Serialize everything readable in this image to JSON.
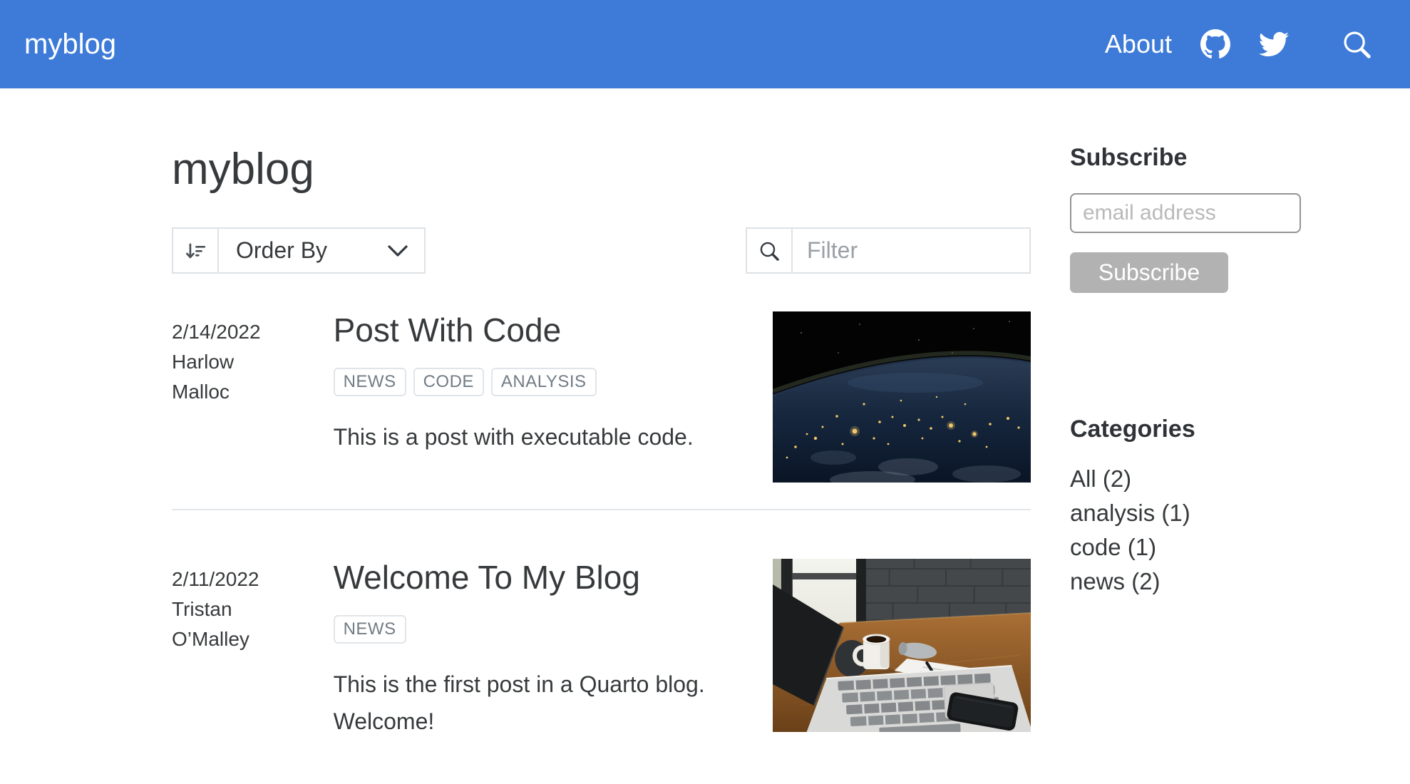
{
  "navbar": {
    "brand": "myblog",
    "about_label": "About",
    "icons": [
      "github-icon",
      "twitter-icon",
      "search-icon"
    ]
  },
  "listing": {
    "title": "myblog",
    "order_by_label": "Order By",
    "filter_placeholder": "Filter"
  },
  "posts": [
    {
      "date": "2/14/2022",
      "author": "Harlow Malloc",
      "title": "Post With Code",
      "tags": [
        "NEWS",
        "CODE",
        "ANALYSIS"
      ],
      "description": "This is a post with executable code.",
      "image": "earth-at-night-from-space"
    },
    {
      "date": "2/11/2022",
      "author": "Tristan O’Malley",
      "title": "Welcome To My Blog",
      "tags": [
        "NEWS"
      ],
      "description": "This is the first post in a Quarto blog. Welcome!",
      "image": "desk-with-laptop-and-coffee"
    }
  ],
  "sidebar": {
    "subscribe": {
      "heading": "Subscribe",
      "email_placeholder": "email address",
      "button_label": "Subscribe"
    },
    "categories": {
      "heading": "Categories",
      "items": [
        "All (2)",
        "analysis (1)",
        "code (1)",
        "news (2)"
      ]
    }
  },
  "colors": {
    "navbar_bg": "#3e7bd8",
    "subscribe_button_bg": "#b2b2b2",
    "body_text": "#373a3c",
    "tag_text": "#727c85",
    "border_light": "#dee2e6"
  }
}
